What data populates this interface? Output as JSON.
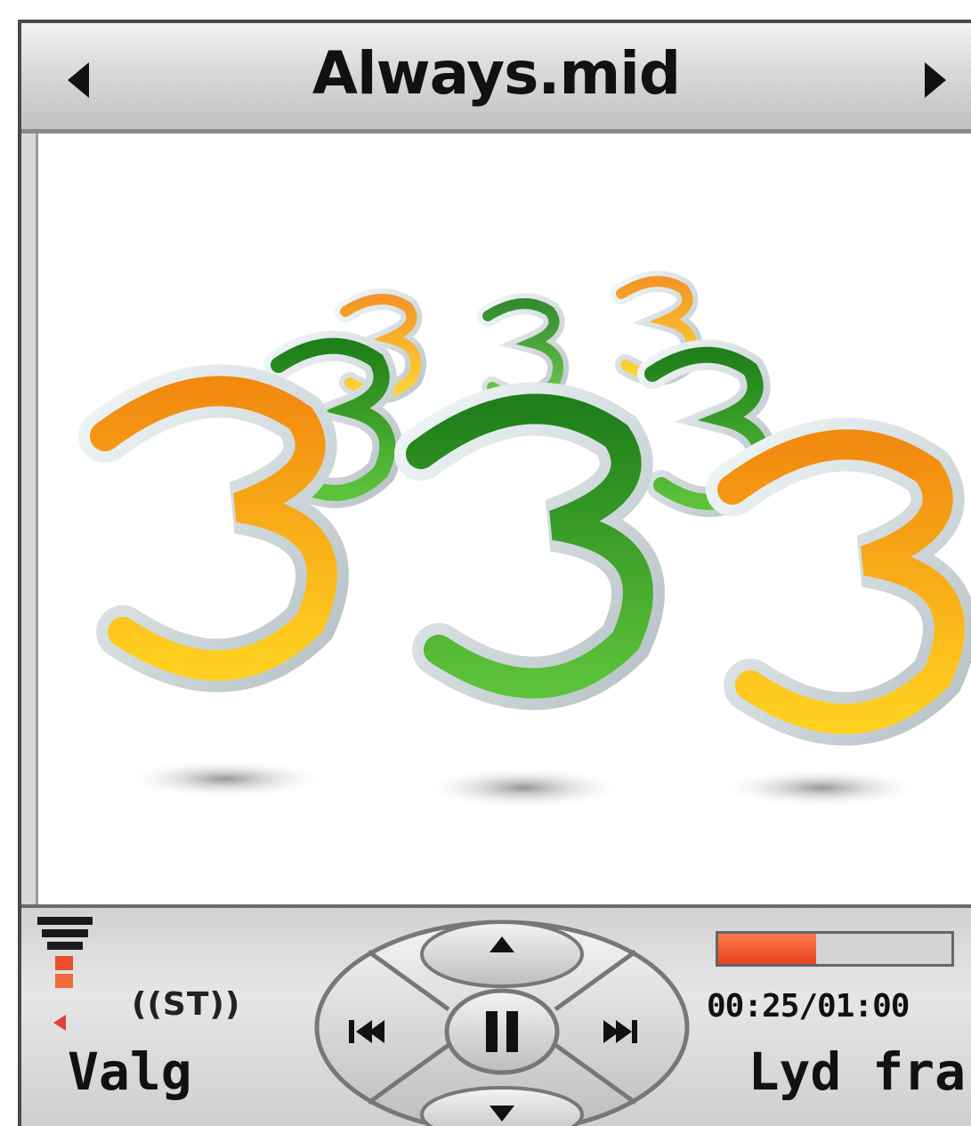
{
  "player": {
    "title": "Always.mid",
    "prev_icon": "triangle-left-icon",
    "next_icon": "triangle-right-icon"
  },
  "artwork": {
    "glyph": "3",
    "colors": {
      "orange": "#f5a11a",
      "yellow": "#ffd21a",
      "green": "#2f9a2a",
      "shadow": "#9a9a9a"
    }
  },
  "status": {
    "signal_icon": "signal-strength-icon",
    "battery_icon": "battery-icon",
    "stereo_label": "((ST))"
  },
  "controls": {
    "up_icon": "arrow-up-icon",
    "down_icon": "arrow-down-icon",
    "previous_icon": "skip-previous-icon",
    "pause_icon": "pause-icon",
    "next_icon": "skip-next-icon"
  },
  "playback": {
    "progress": 0.42,
    "time": "00:25/01:00"
  },
  "softkeys": {
    "left": "Valg",
    "right": "Lyd fra"
  },
  "accent": {
    "progress_color": "#f05a28"
  }
}
